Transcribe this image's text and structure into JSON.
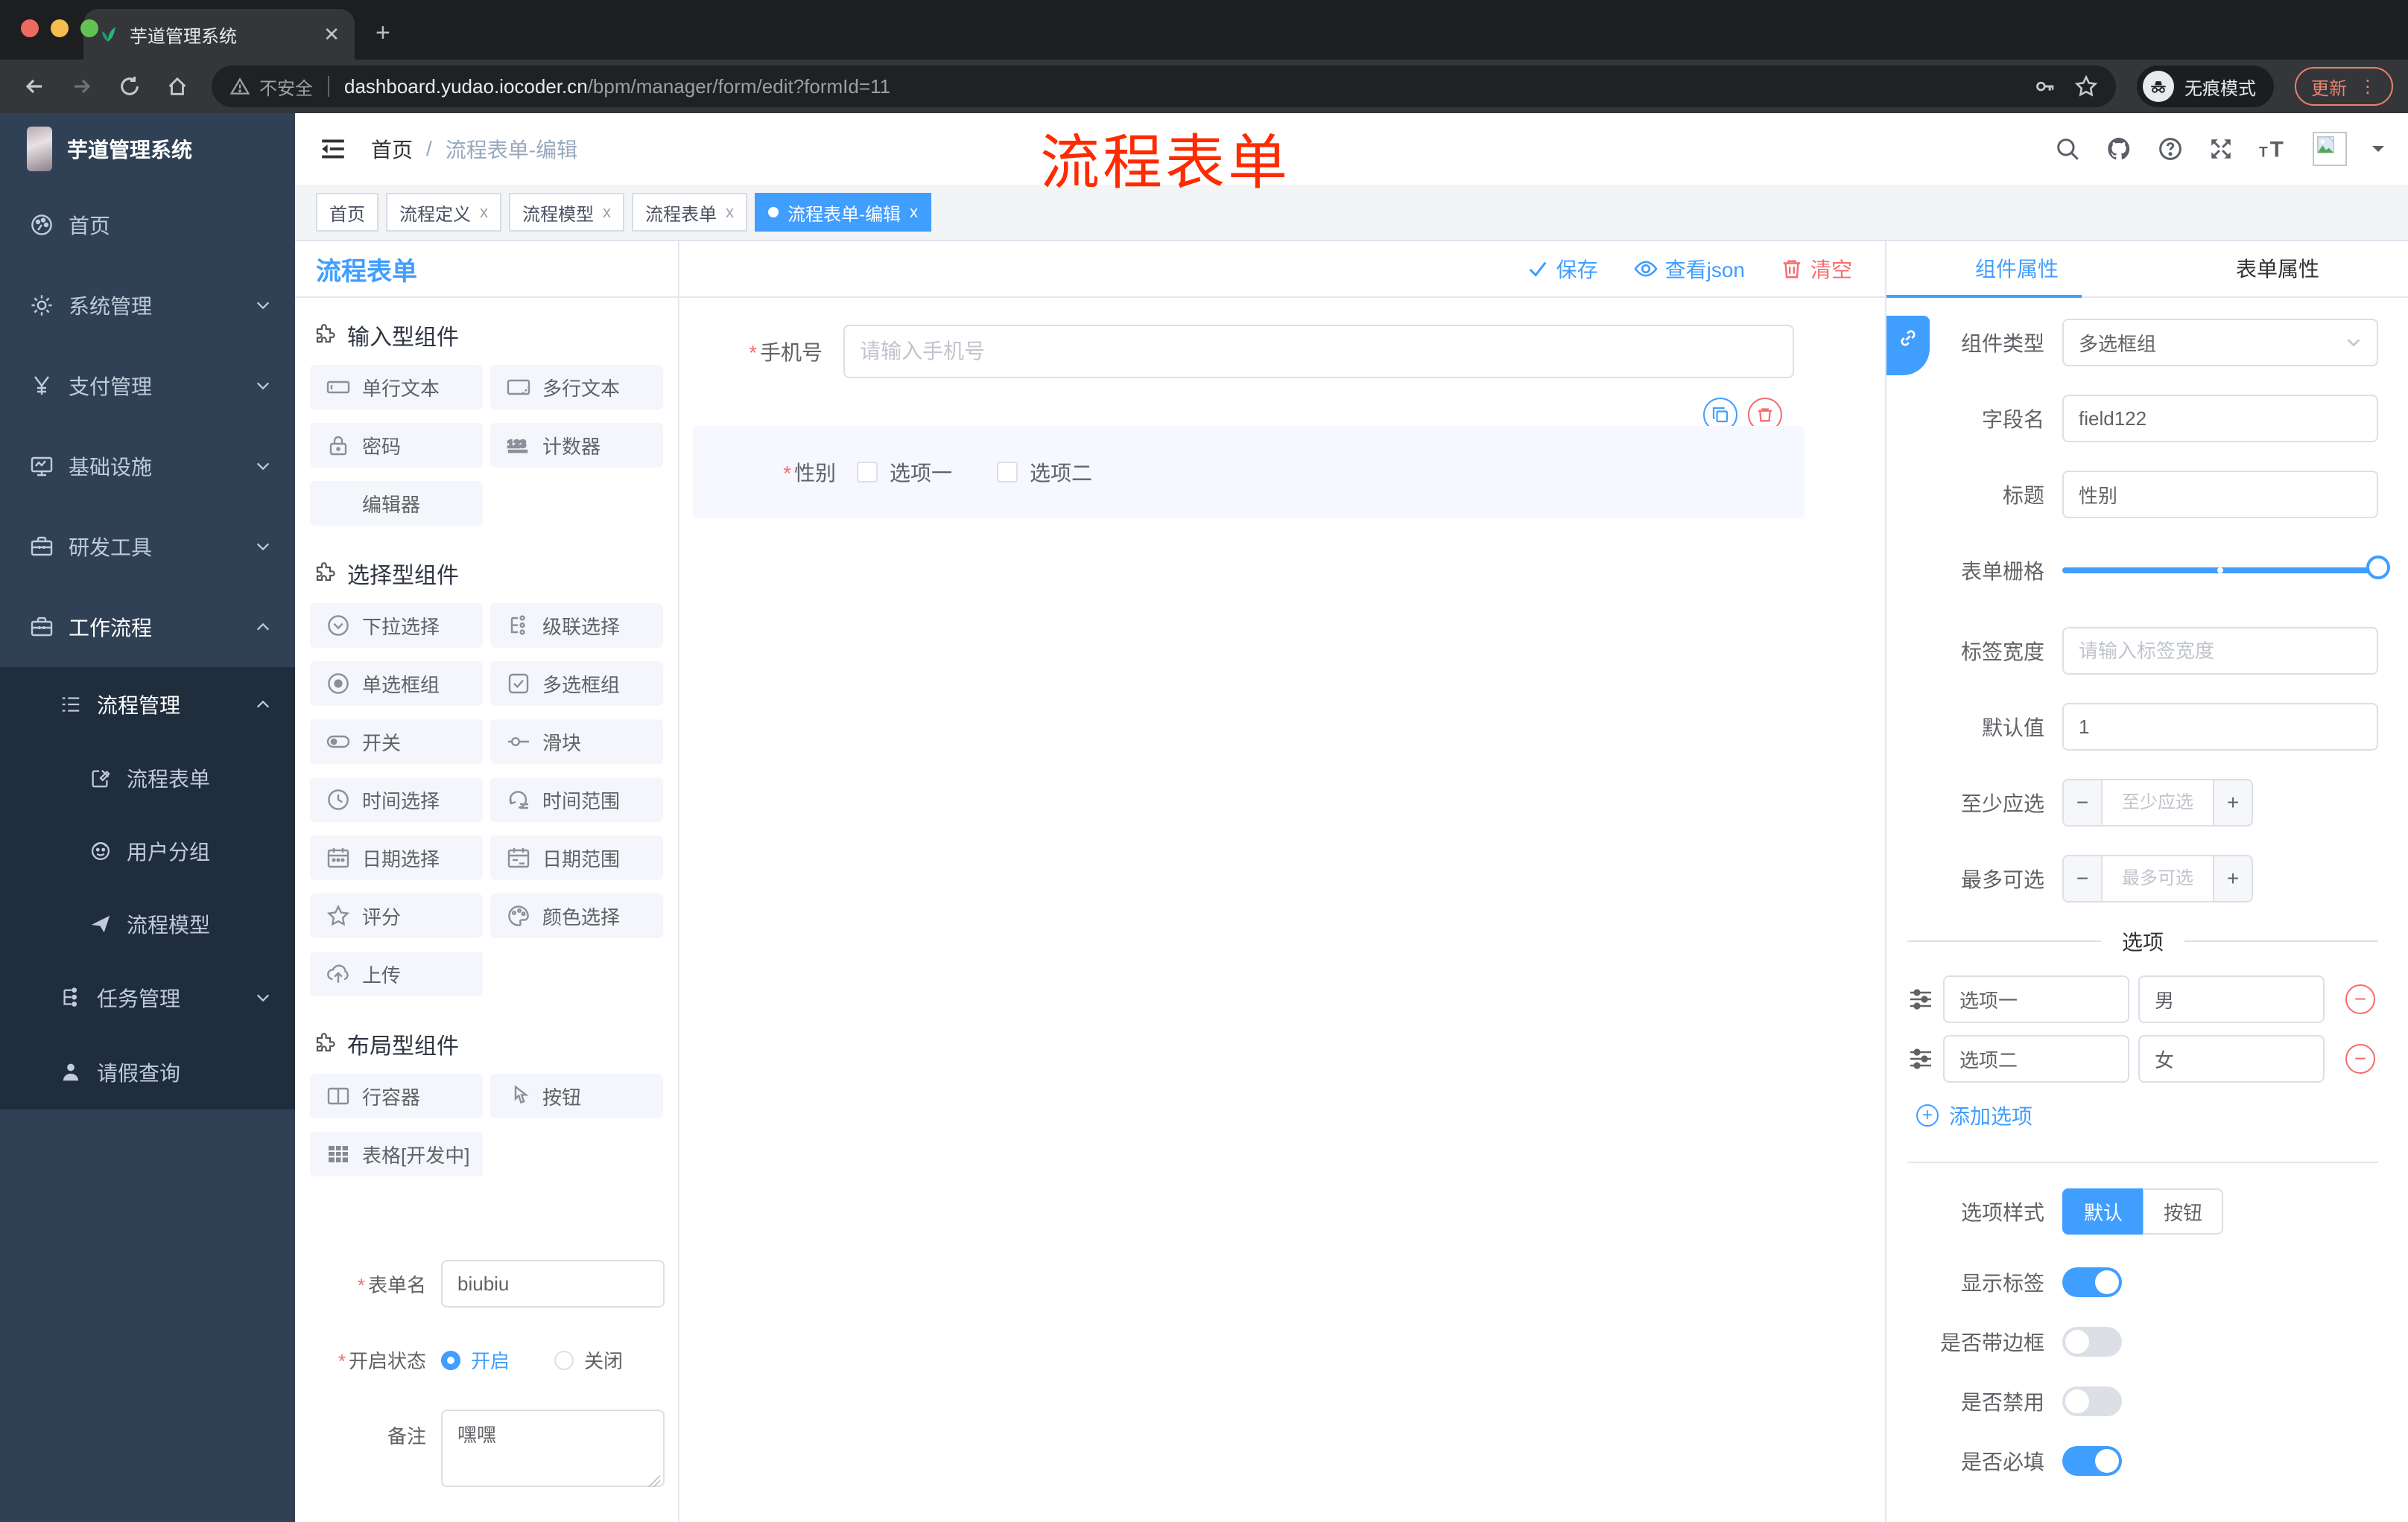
{
  "colors": {
    "accent": "#409EFF",
    "danger": "#F56C6C",
    "annotation_red": "#FF2B00",
    "sidebar_bg": "#304156",
    "submenu_bg": "#1F2D3D",
    "selected_block_bg": "#F6F7FF",
    "update_badge": "#E8836F"
  },
  "browser": {
    "tab_title": "芋道管理系统",
    "security_label": "不安全",
    "url_domain": "dashboard.yudao.iocoder.cn",
    "url_path": "/bpm/manager/form/edit?formId=11",
    "incognito_label": "无痕模式",
    "update_label": "更新",
    "menu_dots": "⋮",
    "new_tab_glyph": "+",
    "close_glyph": "✕"
  },
  "annotation": {
    "text": "流程表单"
  },
  "sidebar": {
    "title": "芋道管理系统",
    "items": [
      {
        "label": "首页",
        "icon": "dashboard-icon"
      },
      {
        "label": "系统管理",
        "icon": "gear-icon"
      },
      {
        "label": "支付管理",
        "icon": "yen-icon"
      },
      {
        "label": "基础设施",
        "icon": "monitor-icon"
      },
      {
        "label": "研发工具",
        "icon": "toolbox-icon"
      },
      {
        "label": "工作流程",
        "icon": "toolbox-icon"
      },
      {
        "label": "流程管理",
        "icon": "list-icon"
      },
      {
        "label": "流程表单",
        "icon": "form-edit-icon"
      },
      {
        "label": "用户分组",
        "icon": "user-group-icon"
      },
      {
        "label": "流程模型",
        "icon": "paper-plane-icon"
      },
      {
        "label": "任务管理",
        "icon": "tree-icon"
      },
      {
        "label": "请假查询",
        "icon": "person-icon"
      }
    ]
  },
  "header": {
    "breadcrumb": {
      "home": "首页",
      "sep": "/",
      "current": "流程表单-编辑"
    }
  },
  "tags": [
    {
      "label": "首页"
    },
    {
      "label": "流程定义",
      "close": "x"
    },
    {
      "label": "流程模型",
      "close": "x"
    },
    {
      "label": "流程表单",
      "close": "x"
    },
    {
      "label": "流程表单-编辑",
      "close": "x",
      "active": true
    }
  ],
  "editor": {
    "title": "流程表单",
    "actions": {
      "save": "保存",
      "view_json": "查看json",
      "clear": "清空"
    }
  },
  "palette": {
    "sections": [
      {
        "title": "输入型组件",
        "items": [
          {
            "label": "单行文本",
            "icon": "input-icon"
          },
          {
            "label": "多行文本",
            "icon": "textarea-icon"
          },
          {
            "label": "密码",
            "icon": "lock-icon"
          },
          {
            "label": "计数器",
            "icon": "counter-icon"
          },
          {
            "label": "编辑器",
            "icon": ""
          }
        ]
      },
      {
        "title": "选择型组件",
        "items": [
          {
            "label": "下拉选择",
            "icon": "select-icon"
          },
          {
            "label": "级联选择",
            "icon": "cascader-icon"
          },
          {
            "label": "单选框组",
            "icon": "radio-icon"
          },
          {
            "label": "多选框组",
            "icon": "checkbox-icon"
          },
          {
            "label": "开关",
            "icon": "switch-icon"
          },
          {
            "label": "滑块",
            "icon": "slider-icon"
          },
          {
            "label": "时间选择",
            "icon": "time-icon"
          },
          {
            "label": "时间范围",
            "icon": "time-range-icon"
          },
          {
            "label": "日期选择",
            "icon": "date-icon"
          },
          {
            "label": "日期范围",
            "icon": "date-range-icon"
          },
          {
            "label": "评分",
            "icon": "rate-icon"
          },
          {
            "label": "颜色选择",
            "icon": "color-icon"
          },
          {
            "label": "上传",
            "icon": "upload-icon"
          }
        ]
      },
      {
        "title": "布局型组件",
        "items": [
          {
            "label": "行容器",
            "icon": "row-container-icon"
          },
          {
            "label": "按钮",
            "icon": "button-icon"
          },
          {
            "label": "表格[开发中]",
            "icon": "table-icon"
          }
        ]
      }
    ]
  },
  "form_meta": {
    "name_label": "表单名",
    "name_value": "biubiu",
    "status_label": "开启状态",
    "status_on": "开启",
    "status_off": "关闭",
    "remark_label": "备注",
    "remark_value": "嘿嘿"
  },
  "canvas": {
    "phone": {
      "label": "手机号",
      "placeholder": "请输入手机号"
    },
    "gender": {
      "label": "性别",
      "option1": "选项一",
      "option2": "选项二"
    }
  },
  "panel": {
    "tabs": {
      "component": "组件属性",
      "form": "表单属性"
    },
    "component_type": {
      "label": "组件类型",
      "value": "多选框组"
    },
    "field_name": {
      "label": "字段名",
      "value": "field122"
    },
    "title": {
      "label": "标题",
      "value": "性别"
    },
    "grid": {
      "label": "表单栅格"
    },
    "label_width": {
      "label": "标签宽度",
      "placeholder": "请输入标签宽度"
    },
    "default_value": {
      "label": "默认值",
      "value": "1"
    },
    "min_checked": {
      "label": "至少应选",
      "placeholder": "至少应选"
    },
    "max_checked": {
      "label": "最多可选",
      "placeholder": "最多可选"
    },
    "options_divider": "选项",
    "options": [
      {
        "label": "选项一",
        "value": "男"
      },
      {
        "label": "选项二",
        "value": "女"
      }
    ],
    "add_option": "添加选项",
    "option_style": {
      "label": "选项样式",
      "default": "默认",
      "button": "按钮"
    },
    "switch_show_label": "显示标签",
    "switch_border": "是否带边框",
    "switch_disabled": "是否禁用",
    "switch_required": "是否必填"
  }
}
